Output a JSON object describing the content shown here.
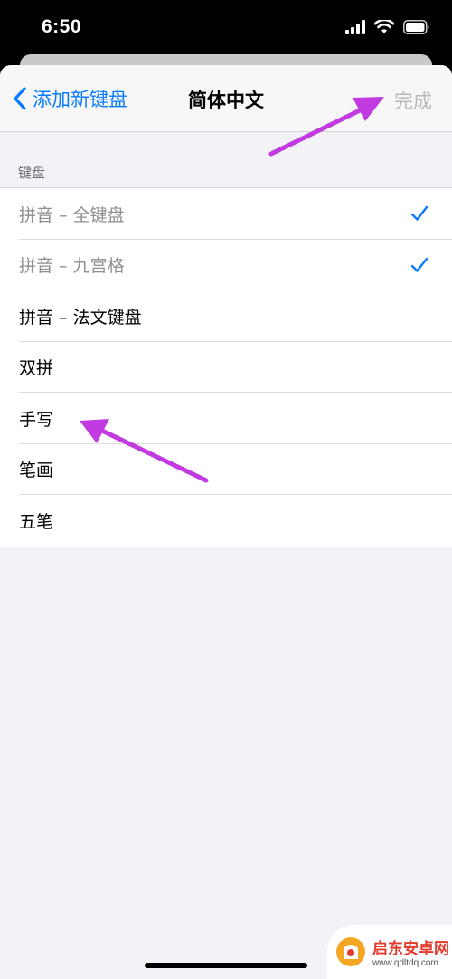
{
  "status_bar": {
    "time": "6:50"
  },
  "nav": {
    "back_label": "添加新键盘",
    "title": "简体中文",
    "done_label": "完成"
  },
  "section": {
    "header": "键盘"
  },
  "keyboards": [
    {
      "label": "拼音 – 全键盘",
      "checked": true,
      "enabled": false
    },
    {
      "label": "拼音 – 九宫格",
      "checked": true,
      "enabled": false
    },
    {
      "label": "拼音 – 法文键盘",
      "checked": false,
      "enabled": true
    },
    {
      "label": "双拼",
      "checked": false,
      "enabled": true
    },
    {
      "label": "手写",
      "checked": false,
      "enabled": true
    },
    {
      "label": "笔画",
      "checked": false,
      "enabled": true
    },
    {
      "label": "五笔",
      "checked": false,
      "enabled": true
    }
  ],
  "watermark": {
    "name": "启东安卓网",
    "url": "www.qdltdq.com"
  },
  "colors": {
    "accent": "#0a7bff",
    "annotation_arrow": "#c13be0",
    "disabled_text": "#8e8e93"
  }
}
